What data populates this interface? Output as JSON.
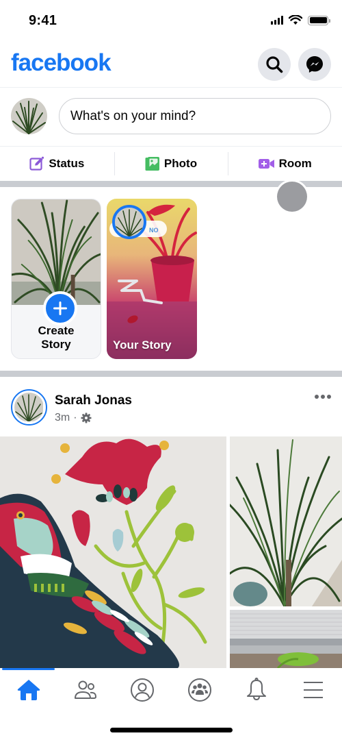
{
  "status_bar": {
    "time": "9:41"
  },
  "header": {
    "logo": "facebook",
    "search_icon": "search-icon",
    "messenger_icon": "messenger-icon"
  },
  "composer": {
    "placeholder": "What's on your mind?",
    "actions": [
      {
        "label": "Status",
        "icon": "edit-icon",
        "color": "#8c5ad8"
      },
      {
        "label": "Photo",
        "icon": "photo-icon",
        "color": "#45bd62"
      },
      {
        "label": "Room",
        "icon": "video-plus-icon",
        "color": "#a25ee8"
      }
    ]
  },
  "stories": {
    "create": {
      "label": "Create\nStory"
    },
    "own": {
      "label": "Your Story",
      "sticker_text": "NO"
    }
  },
  "post": {
    "author": "Sarah Jonas",
    "time": "3m",
    "separator": "·",
    "privacy_icon": "gear-icon",
    "photo_count": 3
  },
  "tab_bar": {
    "tabs": [
      {
        "name": "home",
        "active": true
      },
      {
        "name": "friends",
        "active": false
      },
      {
        "name": "profile",
        "active": false
      },
      {
        "name": "groups",
        "active": false
      },
      {
        "name": "notifications",
        "active": false
      },
      {
        "name": "menu",
        "active": false
      }
    ]
  },
  "colors": {
    "brand": "#1877f2",
    "icon_gray": "#65676b",
    "divider": "#c9ccd1"
  }
}
